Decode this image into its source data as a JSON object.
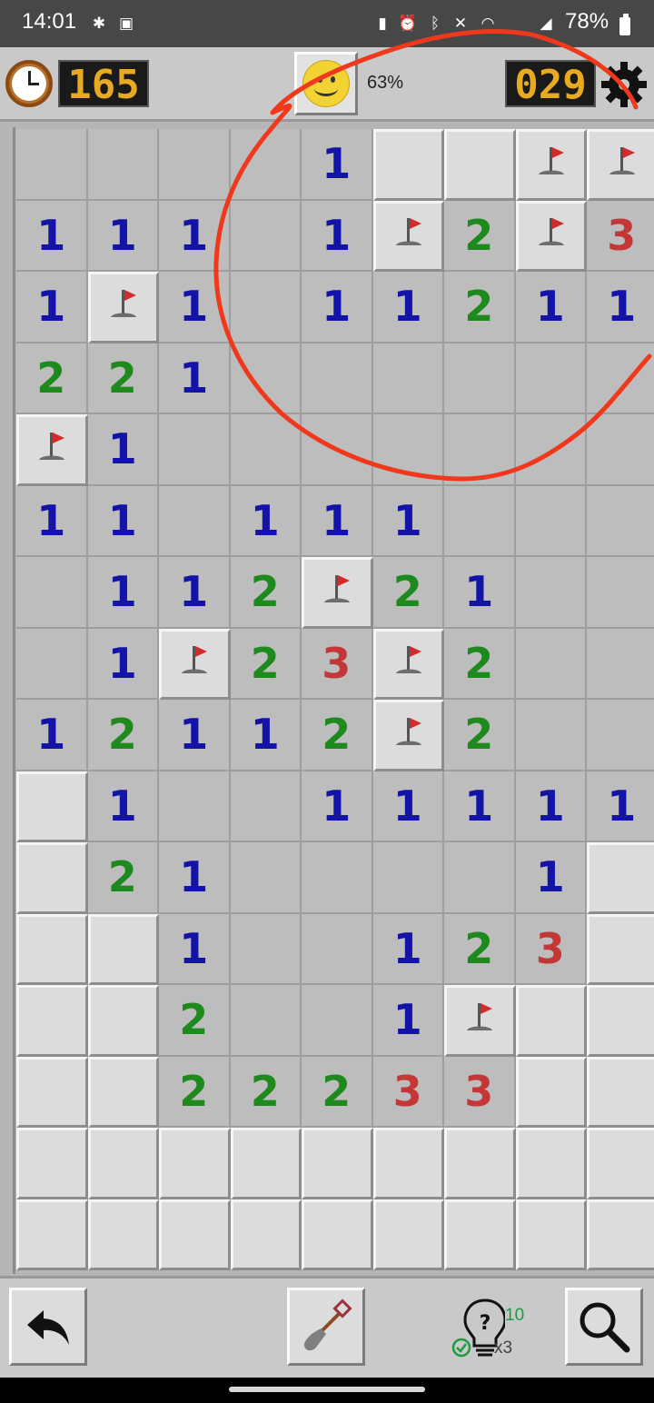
{
  "status_bar": {
    "time": "14:01",
    "battery": "78%"
  },
  "header": {
    "timer": "165",
    "mines_left": "029",
    "progress": "63%",
    "icons": [
      "clock-icon",
      "smiley-face-icon",
      "gear-icon"
    ]
  },
  "board": {
    "columns": 9,
    "rows": 16,
    "cells": [
      [
        "",
        "",
        "",
        "",
        "1",
        "C",
        "C",
        "F",
        "F"
      ],
      [
        "1",
        "1",
        "1",
        "",
        "1",
        "F",
        "2",
        "F",
        "3"
      ],
      [
        "1",
        "F",
        "1",
        "",
        "1",
        "1",
        "2",
        "1",
        "1"
      ],
      [
        "2",
        "2",
        "1",
        "",
        "",
        "",
        "",
        "",
        ""
      ],
      [
        "F",
        "1",
        "",
        "",
        "",
        "",
        "",
        "",
        ""
      ],
      [
        "1",
        "1",
        "",
        "1",
        "1",
        "1",
        "",
        "",
        ""
      ],
      [
        "",
        "1",
        "1",
        "2",
        "F",
        "2",
        "1",
        "",
        ""
      ],
      [
        "",
        "1",
        "F",
        "2",
        "3",
        "F",
        "2",
        "",
        ""
      ],
      [
        "1",
        "2",
        "1",
        "1",
        "2",
        "F",
        "2",
        "",
        ""
      ],
      [
        "C",
        "1",
        "",
        "",
        "1",
        "1",
        "1",
        "1",
        "1"
      ],
      [
        "C",
        "2",
        "1",
        "",
        "",
        "",
        "",
        "1",
        "C"
      ],
      [
        "C",
        "C",
        "1",
        "",
        "",
        "1",
        "2",
        "3",
        "C"
      ],
      [
        "C",
        "C",
        "2",
        "",
        "",
        "1",
        "F",
        "C",
        "C"
      ],
      [
        "C",
        "C",
        "2",
        "2",
        "2",
        "3",
        "3",
        "C",
        "C"
      ],
      [
        "C",
        "C",
        "C",
        "C",
        "C",
        "C",
        "C",
        "C",
        "C"
      ],
      [
        "C",
        "C",
        "C",
        "C",
        "C",
        "C",
        "C",
        "C",
        "C"
      ]
    ],
    "legend": {
      "C": "closed",
      "F": "flag",
      "": "open-empty"
    },
    "number_colors": {
      "1": "#1313a8",
      "2": "#1e8a1e",
      "3": "#c43737"
    }
  },
  "toolbar": {
    "hint_count": "10",
    "hint_multiplier": "x3",
    "icons": [
      "undo-icon",
      "shovel-icon",
      "hint-bulb-icon",
      "magnifier-icon"
    ]
  },
  "annotation": {
    "color": "#f0391c"
  }
}
